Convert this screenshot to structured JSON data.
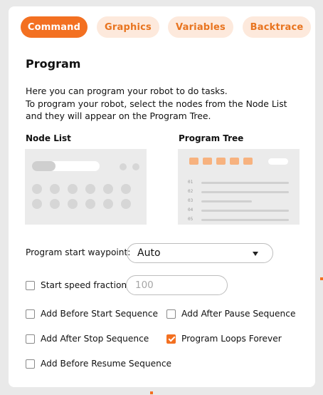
{
  "tabs": [
    {
      "label": "Command",
      "active": true
    },
    {
      "label": "Graphics",
      "active": false
    },
    {
      "label": "Variables",
      "active": false
    },
    {
      "label": "Backtrace",
      "active": false
    }
  ],
  "section_title": "Program",
  "description": [
    "Here you can program your robot to do tasks.",
    "To program your robot, select the nodes from the Node List",
    "and they will appear on the Program Tree."
  ],
  "node_list_label": "Node List",
  "program_tree_label": "Program Tree",
  "program_tree_line_numbers": [
    "01",
    "02",
    "03",
    "04",
    "05"
  ],
  "waypoint": {
    "label": "Program start waypoint:",
    "value": "Auto"
  },
  "speed": {
    "label": "Start speed fraction",
    "placeholder": "100",
    "checked": false
  },
  "options": [
    {
      "label": "Add Before Start Sequence",
      "checked": false
    },
    {
      "label": "Add After Pause Sequence",
      "checked": false
    },
    {
      "label": "Add After Stop Sequence",
      "checked": false
    },
    {
      "label": "Program Loops Forever",
      "checked": true
    },
    {
      "label": "Add Before Resume Sequence",
      "checked": false
    }
  ],
  "colors": {
    "accent": "#f37021",
    "accent_light": "#fde9dc"
  }
}
